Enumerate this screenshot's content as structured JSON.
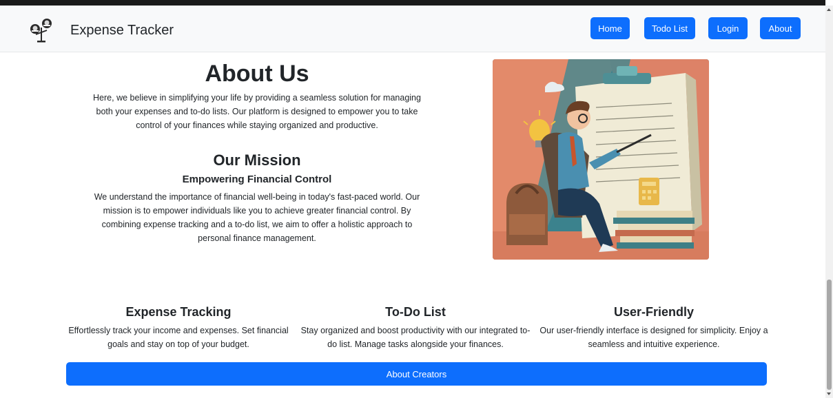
{
  "brand": {
    "title": "Expense Tracker"
  },
  "nav": {
    "home": "Home",
    "todo": "Todo List",
    "login": "Login",
    "about": "About"
  },
  "about": {
    "title": "About Us",
    "body": "Here, we believe in simplifying your life by providing a seamless solution for managing both your expenses and to-do lists. Our platform is designed to empower you to take control of your finances while staying organized and productive."
  },
  "mission": {
    "title": "Our Mission",
    "subtitle": "Empowering Financial Control",
    "body": "We understand the importance of financial well-being in today's fast-paced world. Our mission is to empower individuals like you to achieve greater financial control. By combining expense tracking and a to-do list, we aim to offer a holistic approach to personal finance management."
  },
  "features": [
    {
      "title": "Expense Tracking",
      "body": "Effortlessly track your income and expenses. Set financial goals and stay on top of your budget."
    },
    {
      "title": "To-Do List",
      "body": "Stay organized and boost productivity with our integrated to-do list. Manage tasks alongside your finances."
    },
    {
      "title": "User-Friendly",
      "body": "Our user-friendly interface is designed for simplicity. Enjoy a seamless and intuitive experience."
    }
  ],
  "creators_button": "About Creators",
  "colors": {
    "primary": "#0d6efd",
    "navbar_bg": "#f8f9fa",
    "text": "#212529"
  },
  "icons": {
    "brand": "balance-scale-coins-icon",
    "hero": "man-writing-on-notepad-illustration"
  }
}
